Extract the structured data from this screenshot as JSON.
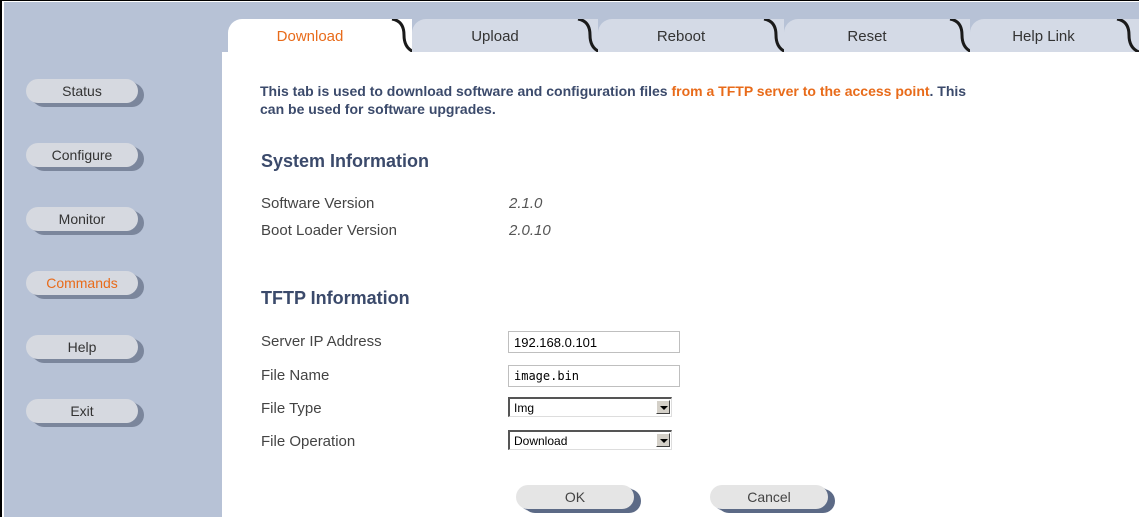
{
  "sidebar": {
    "items": [
      {
        "label": "Status"
      },
      {
        "label": "Configure"
      },
      {
        "label": "Monitor"
      },
      {
        "label": "Commands",
        "active": true
      },
      {
        "label": "Help"
      },
      {
        "label": "Exit"
      }
    ]
  },
  "tabs": [
    {
      "label": "Download",
      "active": true
    },
    {
      "label": "Upload"
    },
    {
      "label": "Reboot"
    },
    {
      "label": "Reset"
    },
    {
      "label": "Help Link"
    }
  ],
  "intro": {
    "text_1": "This tab is used to download software and configuration files ",
    "highlight_1": "from a TFTP server to the access point",
    "text_2": ". This can be used for software upgrades."
  },
  "system_info": {
    "title": "System Information",
    "software_version_label": "Software Version",
    "software_version_value": "2.1.0",
    "boot_loader_label": "Boot Loader Version",
    "boot_loader_value": "2.0.10"
  },
  "tftp_info": {
    "title": "TFTP Information",
    "server_ip_label": "Server IP Address",
    "server_ip_value": "192.168.0.101",
    "file_name_label": "File Name",
    "file_name_value": "image.bin",
    "file_type_label": "File Type",
    "file_type_value": "Img",
    "file_operation_label": "File Operation",
    "file_operation_value": "Download"
  },
  "actions": {
    "ok_label": "OK",
    "cancel_label": "Cancel"
  },
  "colors": {
    "accent": "#e86b1a",
    "heading": "#3b4a6b",
    "sidebar_bg": "#b7c2d6"
  }
}
